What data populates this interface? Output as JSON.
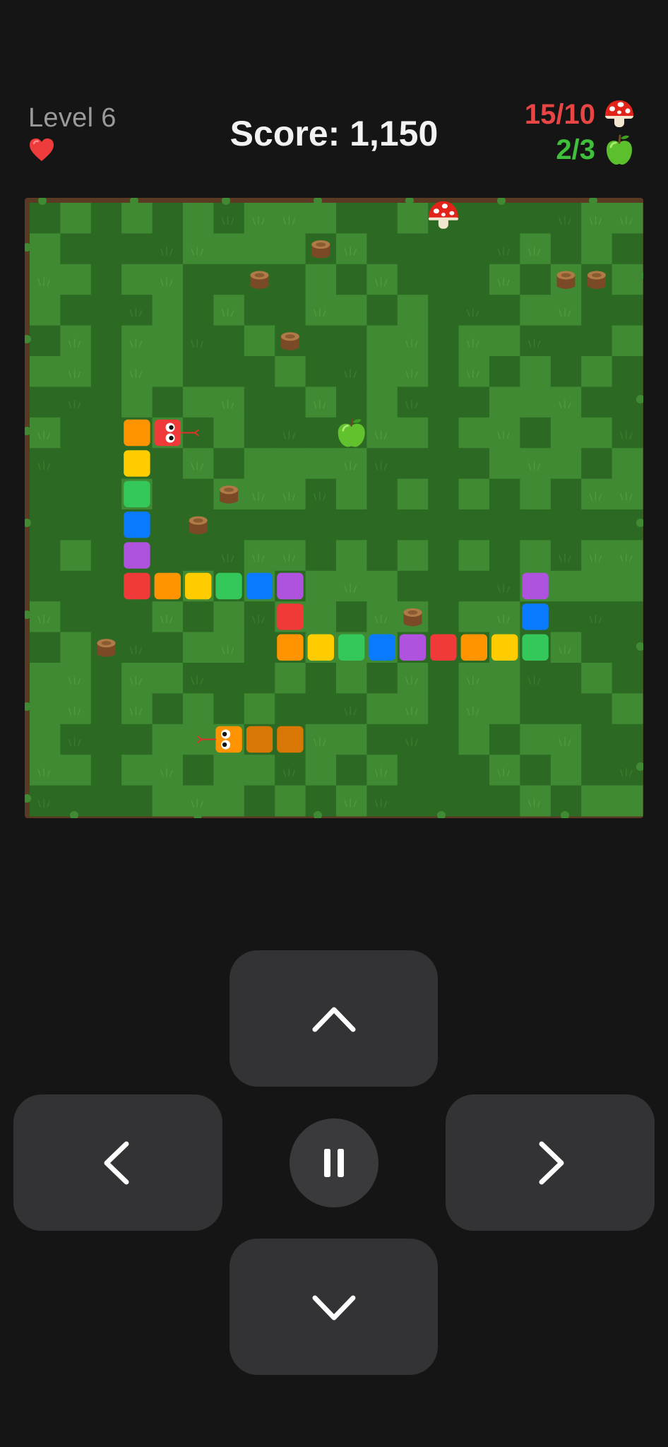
{
  "hud": {
    "level_label": "Level 6",
    "lives": 1,
    "score_label": "Score: 1,150",
    "mushroom_goal": "15/10",
    "apple_goal": "2/3"
  },
  "colors": {
    "grass_light": "#3f8a32",
    "grass_dark": "#2c6a24",
    "border": "#5a3a22",
    "vine_dot": "#3f8a32",
    "snake_red": "#f03a3a",
    "snake_orange": "#ff9300",
    "snake_yellow": "#ffcc00",
    "snake_green": "#34c759",
    "snake_blue": "#0a7aff",
    "snake_purple": "#af52de",
    "enemy_orange": "#d97706",
    "mushroom_goal_color": "#e84545",
    "apple_goal_color": "#3fbf3a",
    "button_bg": "#333335"
  },
  "board": {
    "cols": 20,
    "rows": 20,
    "stumps": [
      [
        9,
        1
      ],
      [
        7,
        2
      ],
      [
        17,
        2
      ],
      [
        18,
        2
      ],
      [
        8,
        4
      ],
      [
        6,
        9
      ],
      [
        5,
        10
      ],
      [
        12,
        13
      ],
      [
        2,
        14
      ]
    ],
    "mushroom": [
      13,
      0
    ],
    "apple": [
      10,
      7
    ],
    "player_snake": [
      {
        "c": 4,
        "r": 7,
        "color": "red",
        "head": true,
        "dir": "right"
      },
      {
        "c": 3,
        "r": 7,
        "color": "orange"
      },
      {
        "c": 3,
        "r": 8,
        "color": "yellow"
      },
      {
        "c": 3,
        "r": 9,
        "color": "green"
      },
      {
        "c": 3,
        "r": 10,
        "color": "blue"
      },
      {
        "c": 3,
        "r": 11,
        "color": "purple"
      },
      {
        "c": 3,
        "r": 12,
        "color": "red"
      },
      {
        "c": 4,
        "r": 12,
        "color": "orange"
      },
      {
        "c": 5,
        "r": 12,
        "color": "yellow"
      },
      {
        "c": 6,
        "r": 12,
        "color": "green"
      },
      {
        "c": 7,
        "r": 12,
        "color": "blue"
      },
      {
        "c": 8,
        "r": 12,
        "color": "purple"
      },
      {
        "c": 8,
        "r": 13,
        "color": "red"
      },
      {
        "c": 8,
        "r": 14,
        "color": "orange"
      },
      {
        "c": 9,
        "r": 14,
        "color": "yellow"
      },
      {
        "c": 10,
        "r": 14,
        "color": "green"
      },
      {
        "c": 11,
        "r": 14,
        "color": "blue"
      },
      {
        "c": 12,
        "r": 14,
        "color": "purple"
      },
      {
        "c": 13,
        "r": 14,
        "color": "red"
      },
      {
        "c": 14,
        "r": 14,
        "color": "orange"
      },
      {
        "c": 15,
        "r": 14,
        "color": "yellow"
      },
      {
        "c": 16,
        "r": 14,
        "color": "green"
      },
      {
        "c": 16,
        "r": 13,
        "color": "blue"
      },
      {
        "c": 16,
        "r": 12,
        "color": "purple"
      }
    ],
    "enemy_snake": [
      {
        "c": 6,
        "r": 17,
        "color": "orange",
        "head": true,
        "dir": "left"
      },
      {
        "c": 7,
        "r": 17,
        "color": "enemy_orange"
      },
      {
        "c": 8,
        "r": 17,
        "color": "enemy_orange"
      }
    ]
  },
  "controls": {
    "up_icon": "chevron-up-icon",
    "left_icon": "chevron-left-icon",
    "right_icon": "chevron-right-icon",
    "down_icon": "chevron-down-icon",
    "pause_icon": "pause-icon"
  }
}
